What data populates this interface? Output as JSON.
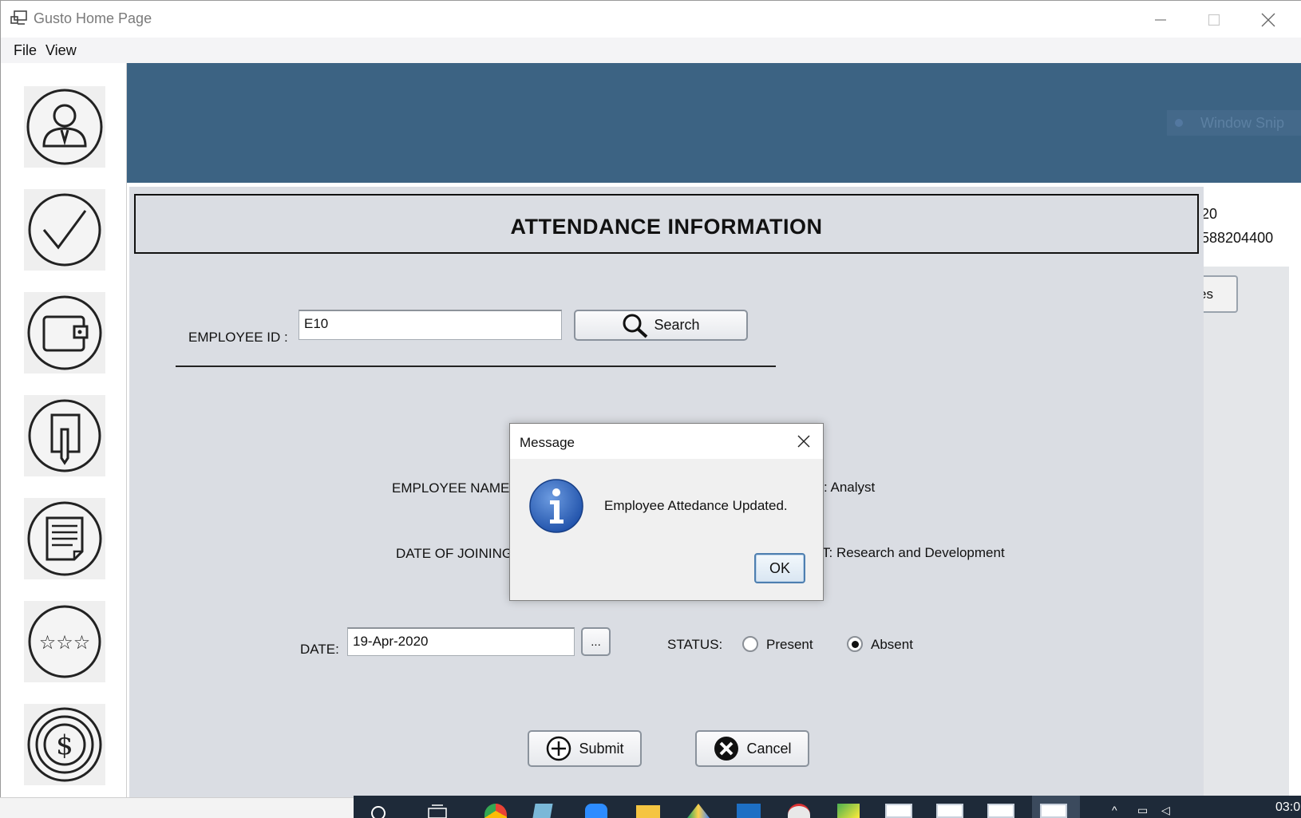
{
  "window": {
    "title": "Gusto Home Page"
  },
  "menu": {
    "file": "File",
    "view": "View"
  },
  "sidebar": {
    "items": [
      {
        "icon": "employee-icon"
      },
      {
        "icon": "checkmark-icon"
      },
      {
        "icon": "wallet-icon"
      },
      {
        "icon": "edit-document-icon"
      },
      {
        "icon": "notes-icon"
      },
      {
        "icon": "rating-stars-icon"
      },
      {
        "icon": "dollar-icon"
      }
    ]
  },
  "background": {
    "overlay_label": "Window Snip",
    "partial_text_1": "20",
    "partial_text_2": "588204400",
    "partial_button": "es"
  },
  "form": {
    "title": "ATTENDANCE INFORMATION",
    "employee_id_label": "EMPLOYEE ID :",
    "employee_id_value": "E10",
    "search_label": "Search",
    "employee_name_label": "EMPLOYEE NAME",
    "date_of_joining_label": "DATE OF JOINING",
    "designation_value": ": Analyst",
    "department_value": "T: Research and Development",
    "date_label": "DATE:",
    "date_value": "19-Apr-2020",
    "date_picker_label": "...",
    "status_label": "STATUS:",
    "status_options": [
      {
        "label": "Present",
        "selected": false
      },
      {
        "label": "Absent",
        "selected": true
      }
    ],
    "submit_label": "Submit",
    "cancel_label": "Cancel"
  },
  "dialog": {
    "title": "Message",
    "message": "Employee Attedance Updated.",
    "ok_label": "OK"
  },
  "taskbar": {
    "time": "03:0"
  },
  "colors": {
    "header_band": "#3c6383",
    "panel_bg": "#dadde3",
    "taskbar_bg": "#1e2a39",
    "dialog_ok_border": "#4e7fb0"
  }
}
